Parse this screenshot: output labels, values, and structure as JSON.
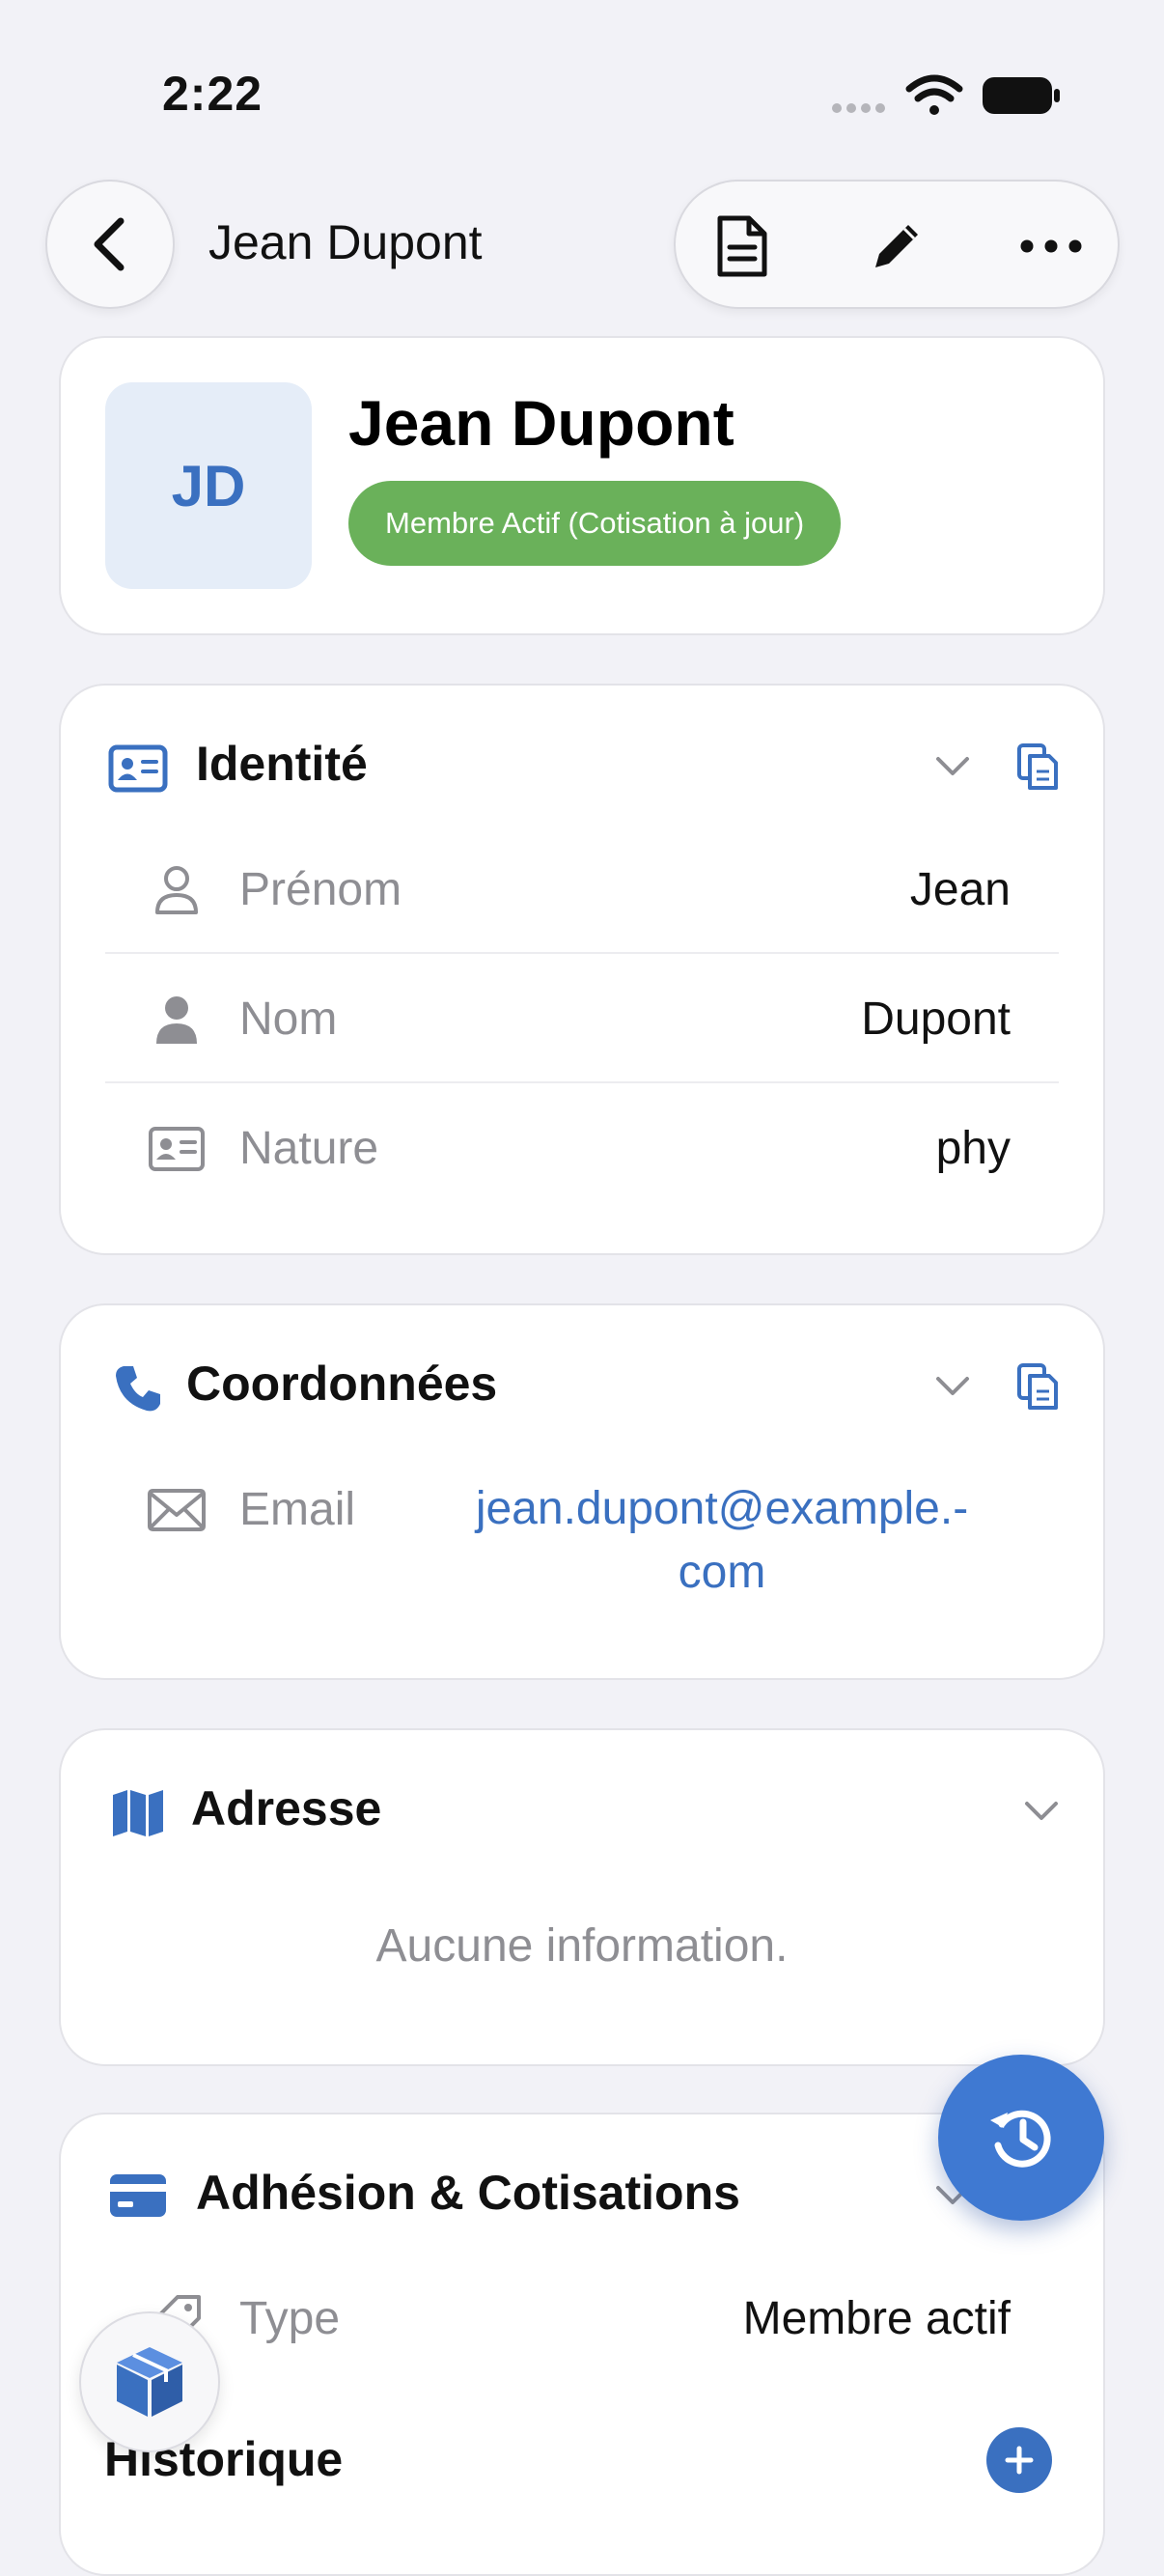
{
  "status_bar": {
    "time": "2:22",
    "icons": [
      "signal-dots-icon",
      "wifi-icon",
      "battery-icon"
    ]
  },
  "nav": {
    "back_icon": "chevron-left-icon",
    "title": "Jean Dupont",
    "actions": [
      "document-icon",
      "pencil-icon",
      "more-icon"
    ]
  },
  "profile": {
    "initials": "JD",
    "name": "Jean Dupont",
    "status": "Membre Actif (Cotisation à jour)",
    "status_color": "#6ab15a",
    "avatar_bg": "#e5edf8"
  },
  "identity": {
    "title": "Identité",
    "rows": [
      {
        "label": "Prénom",
        "value": "Jean"
      },
      {
        "label": "Nom",
        "value": "Dupont"
      },
      {
        "label": "Nature",
        "value": "phy"
      }
    ]
  },
  "contact": {
    "title": "Coordonnées",
    "email_label": "Email",
    "email_line1": "jean.dupont@example.-",
    "email_line2": "com"
  },
  "address": {
    "title": "Adresse",
    "empty": "Aucune information."
  },
  "membership": {
    "title": "Adhésion & Cotisations",
    "type_label": "Type",
    "type_value": "Membre actif",
    "history_title": "Historique"
  },
  "colors": {
    "accent": "#3a70c0",
    "background": "#f2f2f7",
    "muted": "#8e8e93"
  }
}
